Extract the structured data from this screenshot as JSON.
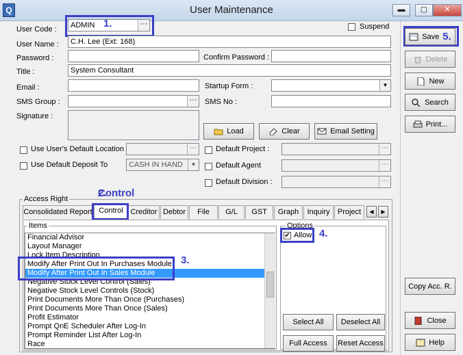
{
  "window": {
    "title": "User Maintenance",
    "minimize": "▬",
    "restore": "▢",
    "close": "✕"
  },
  "form": {
    "user_code_label": "User Code :",
    "user_code_value": "ADMIN",
    "suspend_label": "Suspend",
    "user_name_label": "User Name :",
    "user_name_value": "C.H. Lee (Ext: 168)",
    "password_label": "Password :",
    "confirm_password_label": "Confirm Password :",
    "title_label": "Title :",
    "title_value": "System Consultant",
    "email_label": "Email :",
    "startup_form_label": "Startup Form :",
    "sms_group_label": "SMS Group :",
    "sms_no_label": "SMS No :",
    "signature_label": "Signature :",
    "load_button": "Load",
    "clear_button": "Clear",
    "email_setting_button": "Email Setting",
    "use_default_location_label": "Use User's Default Location",
    "use_default_deposit_label": "Use Default Deposit To",
    "deposit_value": "CASH IN HAND",
    "default_project_label": "Default Project :",
    "default_agent_label": "Default Agent",
    "default_division_label": "Default Division :"
  },
  "access_right": {
    "group_label": "Access Right",
    "tabs": [
      "Consolidated Report",
      "Control",
      "Creditor",
      "Debtor",
      "File",
      "G/L",
      "GST",
      "Graph",
      "Inquiry",
      "Project"
    ],
    "active_tab": "Control",
    "tab_prev": "◀",
    "tab_next": "▶",
    "items_label": "Items",
    "items": [
      "Financial Advisor",
      "Layout Manager",
      "Lock Item Description",
      "Modify After Print Out In Purchases Module",
      "Modify After Print Out In Sales Module",
      "Negative Stock Level Control (Sales)",
      "Negative Stock Level Controls (Stock)",
      "Print Documents More Than Once (Purchases)",
      "Print Documents More Than Once (Sales)",
      "Profit Estimator",
      "Prompt QnE Scheduler After Log-In",
      "Prompt Reminder List After Log-In",
      "Race"
    ],
    "selected_item": "Modify After Print Out In Sales Module",
    "options_label": "Options",
    "allow_label": "Allow",
    "allow_checked": true,
    "select_all": "Select All",
    "deselect_all": "Deselect All",
    "full_access": "Full Access",
    "reset_access": "Reset Access"
  },
  "sidebar": {
    "save": "Save",
    "delete": "Delete",
    "new": "New",
    "search": "Search",
    "print": "Print...",
    "copy_access": "Copy Acc. R.",
    "close": "Close",
    "help": "Help"
  },
  "annotations": {
    "a1": "1.",
    "a2": "2.",
    "a3": "3.",
    "a4": "4.",
    "a5": "5."
  },
  "colors": {
    "annotation": "#3b3fc6",
    "selection": "#3399ff"
  }
}
